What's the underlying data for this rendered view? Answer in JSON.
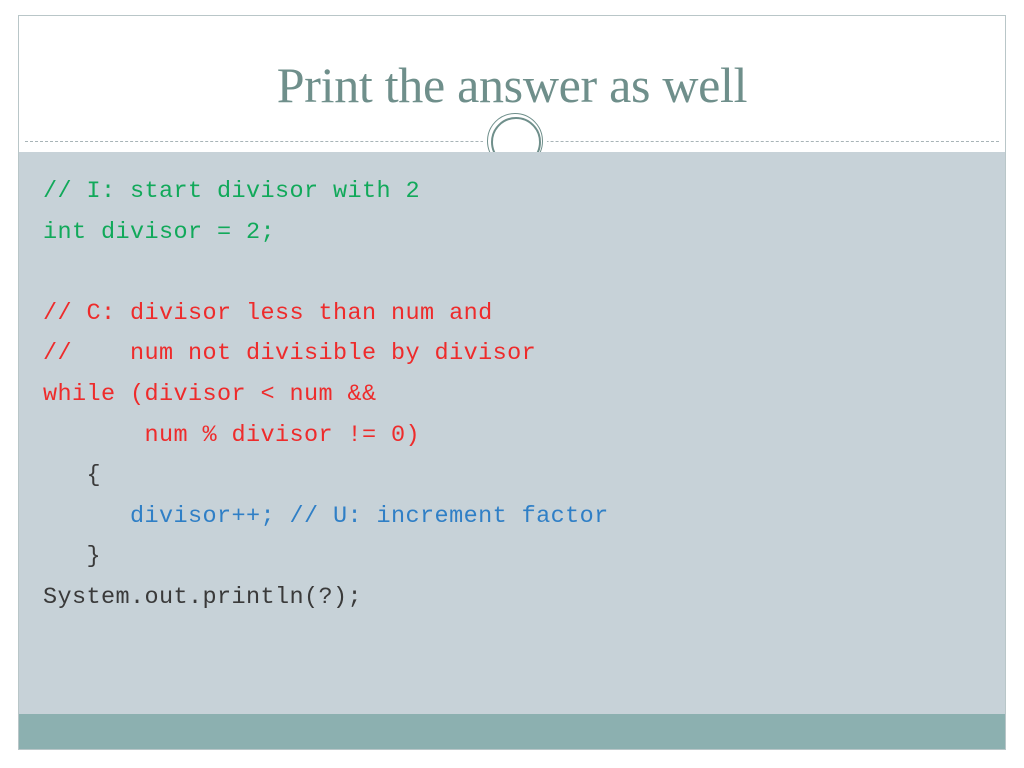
{
  "slide": {
    "title": "Print the answer as well",
    "title_color": "#6f8f8b",
    "body_bg": "#c7d2d8",
    "accent_bar_color": "#8cb0b0",
    "divider_color": "#9aa7ab"
  },
  "ornament": {
    "name": "double-ring-circle",
    "color": "#6f8f8b"
  },
  "code": {
    "language": "java",
    "colors": {
      "green": "#11a95a",
      "red": "#ee2b2b",
      "blue": "#2f7fc6",
      "dark": "#3a3a3a"
    },
    "lines": [
      {
        "text": "// I: start divisor with 2",
        "color": "green"
      },
      {
        "text": "int divisor = 2;",
        "color": "green"
      },
      {
        "text": "",
        "color": "dark"
      },
      {
        "text": "// C: divisor less than num and",
        "color": "red"
      },
      {
        "text": "//    num not divisible by divisor",
        "color": "red"
      },
      {
        "text": "while (divisor < num &&",
        "color": "red"
      },
      {
        "text": "       num % divisor != 0)",
        "color": "red"
      },
      {
        "text": "   {",
        "color": "dark"
      },
      {
        "text": "      divisor++; // U: increment factor",
        "color": "blue"
      },
      {
        "text": "   }",
        "color": "dark"
      },
      {
        "text": "System.out.println(?);",
        "color": "dark"
      }
    ]
  }
}
